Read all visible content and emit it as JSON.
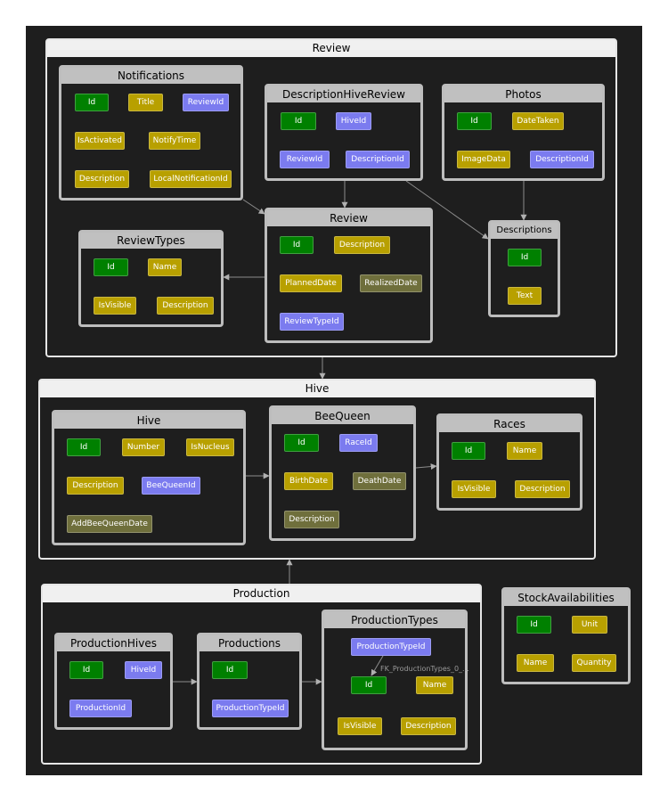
{
  "diagram": {
    "colors": {
      "key": "#008000",
      "attribute": "#b8a000",
      "foreign_key": "#7b7bef",
      "nullable": "#6f6f3c"
    },
    "groups": {
      "review": "Review",
      "hive": "Hive",
      "production": "Production"
    },
    "entities": {
      "notifications": {
        "title": "Notifications",
        "fields": [
          "Id",
          "Title",
          "ReviewId",
          "IsActivated",
          "NotifyTime",
          "Description",
          "LocalNotificationId"
        ],
        "kinds": [
          "key",
          "attribute",
          "foreign_key",
          "attribute",
          "attribute",
          "attribute",
          "attribute"
        ]
      },
      "descriptionhivereview": {
        "title": "DescriptionHiveReview",
        "fields": [
          "Id",
          "HiveId",
          "ReviewId",
          "DescriptionId"
        ],
        "kinds": [
          "key",
          "foreign_key",
          "foreign_key",
          "foreign_key"
        ]
      },
      "photos": {
        "title": "Photos",
        "fields": [
          "Id",
          "DateTaken",
          "ImageData",
          "DescriptionId"
        ],
        "kinds": [
          "key",
          "attribute",
          "attribute",
          "foreign_key"
        ]
      },
      "review": {
        "title": "Review",
        "fields": [
          "Id",
          "Description",
          "PlannedDate",
          "RealizedDate",
          "ReviewTypeId"
        ],
        "kinds": [
          "key",
          "attribute",
          "attribute",
          "nullable",
          "foreign_key"
        ]
      },
      "reviewtypes": {
        "title": "ReviewTypes",
        "fields": [
          "Id",
          "Name",
          "IsVisible",
          "Description"
        ],
        "kinds": [
          "key",
          "attribute",
          "attribute",
          "attribute"
        ]
      },
      "descriptions": {
        "title": "Descriptions",
        "fields": [
          "Id",
          "Text"
        ],
        "kinds": [
          "key",
          "attribute"
        ]
      },
      "hive": {
        "title": "Hive",
        "fields": [
          "Id",
          "Number",
          "IsNucleus",
          "Description",
          "BeeQueenId",
          "AddBeeQueenDate"
        ],
        "kinds": [
          "key",
          "attribute",
          "attribute",
          "attribute",
          "foreign_key",
          "nullable"
        ]
      },
      "beequeen": {
        "title": "BeeQueen",
        "fields": [
          "Id",
          "RaceId",
          "BirthDate",
          "DeathDate",
          "Description"
        ],
        "kinds": [
          "key",
          "foreign_key",
          "attribute",
          "nullable",
          "nullable"
        ]
      },
      "races": {
        "title": "Races",
        "fields": [
          "Id",
          "Name",
          "IsVisible",
          "Description"
        ],
        "kinds": [
          "key",
          "attribute",
          "attribute",
          "attribute"
        ]
      },
      "productionhives": {
        "title": "ProductionHives",
        "fields": [
          "Id",
          "HiveId",
          "ProductionId"
        ],
        "kinds": [
          "key",
          "foreign_key",
          "foreign_key"
        ]
      },
      "productions": {
        "title": "Productions",
        "fields": [
          "Id",
          "ProductionTypeId"
        ],
        "kinds": [
          "key",
          "foreign_key"
        ]
      },
      "productiontypes": {
        "title": "ProductionTypes",
        "fields": [
          "ProductionTypeId",
          "Id",
          "Name",
          "IsVisible",
          "Description"
        ],
        "kinds": [
          "foreign_key",
          "key",
          "attribute",
          "attribute",
          "attribute"
        ]
      },
      "stockavailabilities": {
        "title": "StockAvailabilities",
        "fields": [
          "Id",
          "Unit",
          "Name",
          "Quantity"
        ],
        "kinds": [
          "key",
          "attribute",
          "attribute",
          "attribute"
        ]
      }
    },
    "edge_labels": {
      "self_fk": "FK_ProductionTypes_0_..."
    }
  }
}
